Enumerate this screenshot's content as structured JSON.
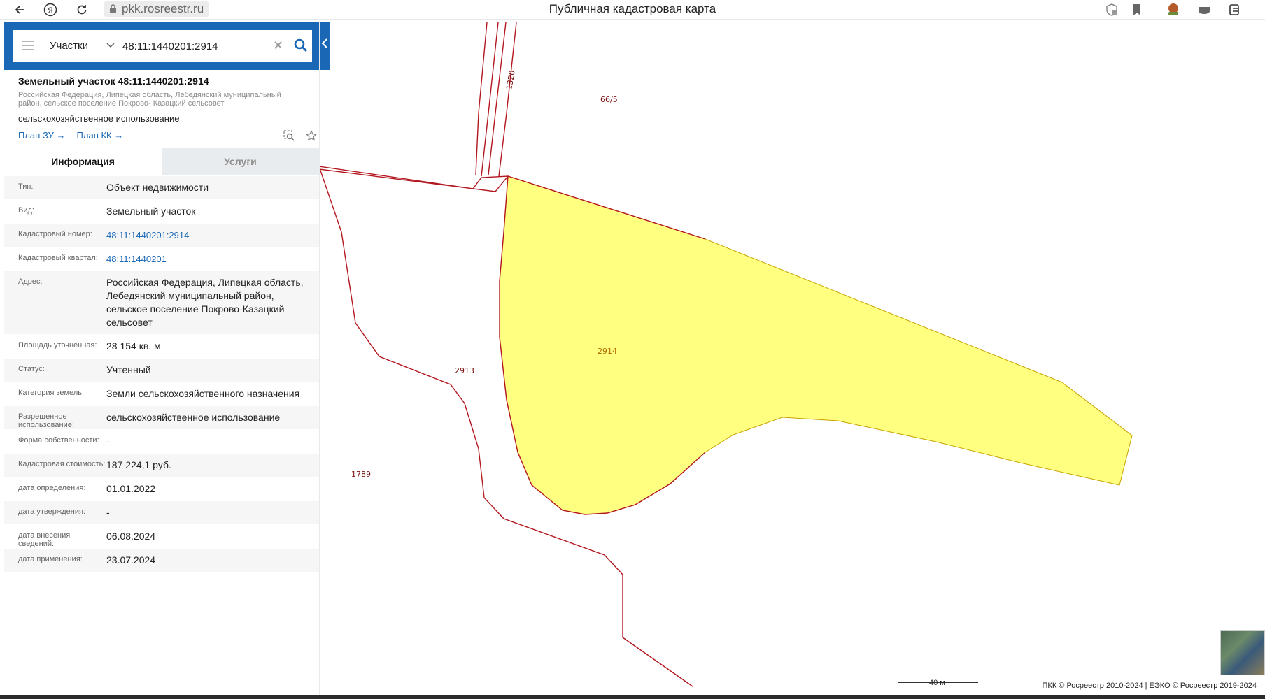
{
  "browser": {
    "url": "pkk.rosreestr.ru",
    "title": "Публичная кадастровая карта"
  },
  "search": {
    "type_label": "Участки",
    "query": "48:11:1440201:2914"
  },
  "object": {
    "title": "Земельный участок 48:11:1440201:2914",
    "address": "Российская Федерация, Липецкая область, Лебедянский муниципальный район, сельское поселение Покрово- Казацкий сельсовет",
    "use": "сельскохозяйственное использование",
    "links": [
      "План ЗУ →",
      "План КК →"
    ]
  },
  "tabs": {
    "info": "Информация",
    "services": "Услуги"
  },
  "rows": [
    {
      "key": "Тип:",
      "value": "Объект недвижимости"
    },
    {
      "key": "Вид:",
      "value": "Земельный участок"
    },
    {
      "key": "Кадастровый номер:",
      "value": "48:11:1440201:2914"
    },
    {
      "key": "Кадастровый квартал:",
      "value": "48:11:1440201"
    },
    {
      "key": "Адрес:",
      "value": "Российская Федерация, Липецкая область, Лебедянский муниципальный район, сельское поселение Покрово-Казацкий сельсовет"
    },
    {
      "key": "Площадь уточненная:",
      "value": "28 154 кв. м"
    },
    {
      "key": "Статус:",
      "value": "Учтенный"
    },
    {
      "key": "Категория земель:",
      "value": "Земли сельскохозяйственного назначения"
    },
    {
      "key": "Разрешенное использование:",
      "value": "сельскохозяйственное использование"
    },
    {
      "key": "Форма собственности:",
      "value": "-"
    },
    {
      "key": "Кадастровая стоимость:",
      "value": "187 224,1 руб."
    },
    {
      "key": "дата определения:",
      "value": "01.01.2022"
    },
    {
      "key": "дата утверждения:",
      "value": "-"
    },
    {
      "key": "дата внесения сведений:",
      "value": "06.08.2024"
    },
    {
      "key": "дата применения:",
      "value": "23.07.2024"
    }
  ],
  "map": {
    "labels": {
      "road": "1320",
      "p665": "66/5",
      "main": "2914",
      "p2913": "2913",
      "p1789": "1789"
    },
    "scale": "40 м",
    "copyright": "ПКК © Росреестр 2010-2024 | ЕЭКО © Росреестр 2019-2024",
    "colors": {
      "parcel_fill": "#ffff80",
      "boundary": "#b3171f",
      "accent": "#1a68b5"
    }
  }
}
